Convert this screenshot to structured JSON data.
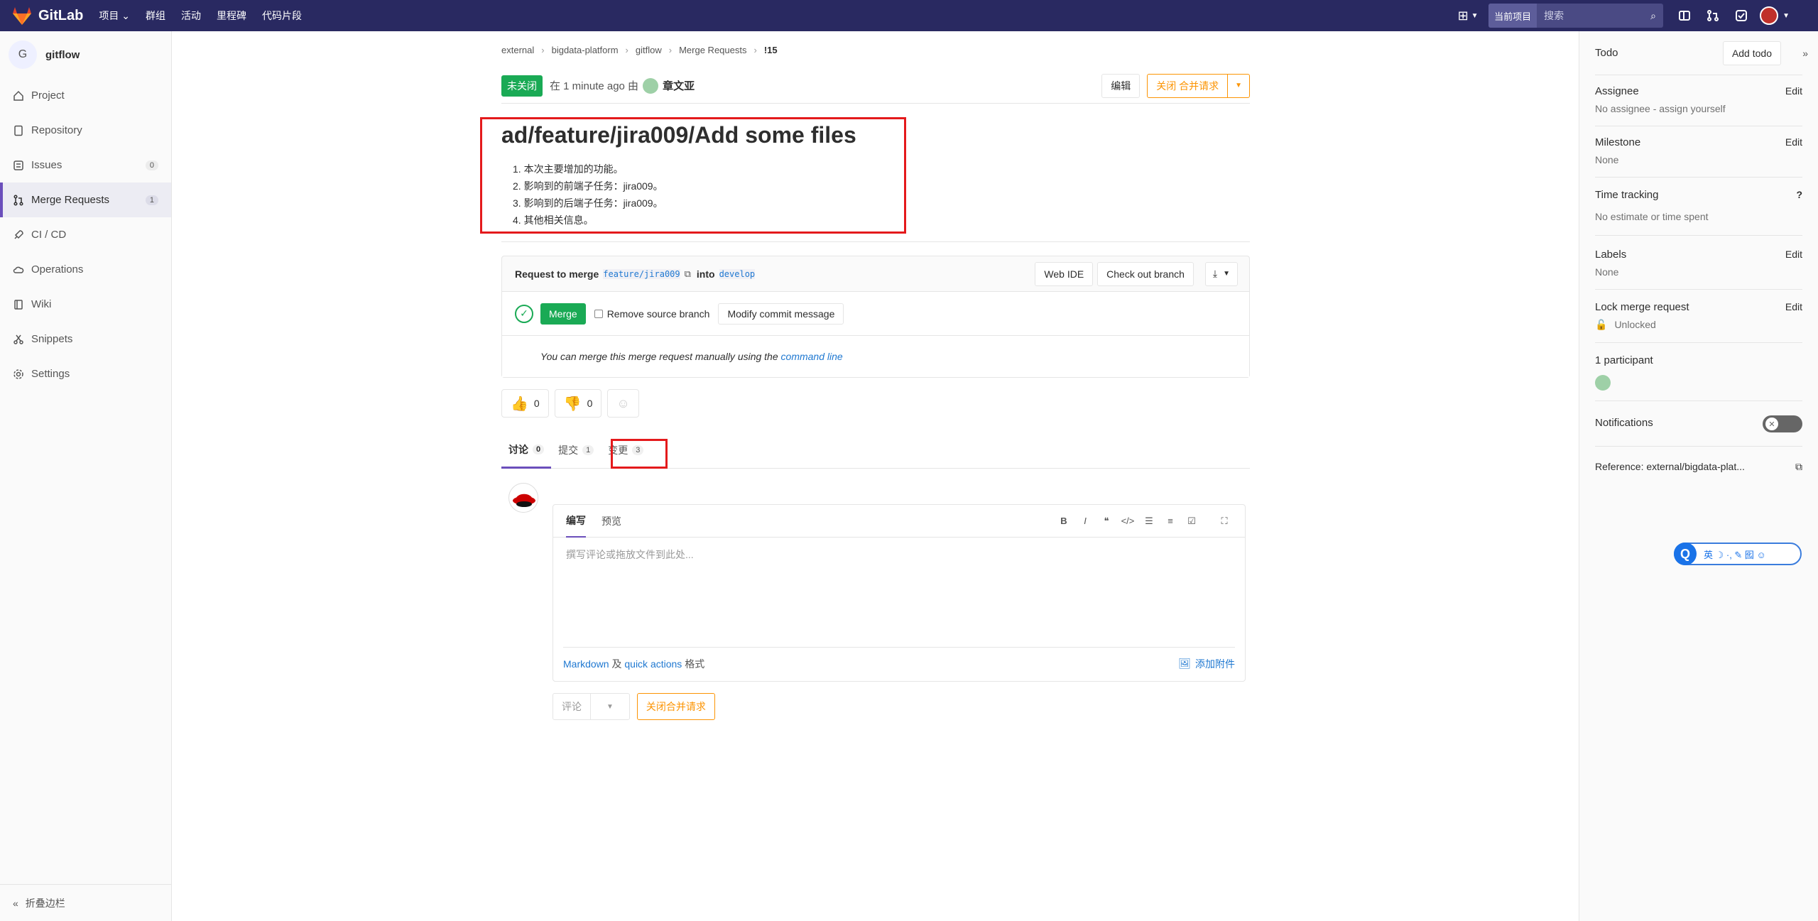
{
  "topnav": {
    "brand": "GitLab",
    "menu": [
      "项目 ⌄",
      "群组",
      "活动",
      "里程碑",
      "代码片段"
    ],
    "search_scope": "当前项目",
    "search_placeholder": "搜索"
  },
  "sidebar": {
    "project_initial": "G",
    "project_name": "gitflow",
    "items": [
      {
        "label": "Project",
        "icon": "home-icon"
      },
      {
        "label": "Repository",
        "icon": "doc-icon"
      },
      {
        "label": "Issues",
        "icon": "issues-icon",
        "badge": "0"
      },
      {
        "label": "Merge Requests",
        "icon": "merge-request-icon",
        "badge": "1",
        "active": true
      },
      {
        "label": "CI / CD",
        "icon": "rocket-icon"
      },
      {
        "label": "Operations",
        "icon": "cloud-icon"
      },
      {
        "label": "Wiki",
        "icon": "book-icon"
      },
      {
        "label": "Snippets",
        "icon": "scissors-icon"
      },
      {
        "label": "Settings",
        "icon": "gear-icon"
      }
    ],
    "collapse_label": "折叠边栏"
  },
  "breadcrumb": [
    "external",
    "bigdata-platform",
    "gitflow",
    "Merge Requests",
    "!15"
  ],
  "mr": {
    "status": "未关闭",
    "meta_prefix": "在 1 minute ago 由",
    "author": "章文亚",
    "edit_label": "编辑",
    "close_label": "关闭 合并请求",
    "title": "ad/feature/jira009/Add some files",
    "description": [
      "1. 本次主要增加的功能。",
      "2. 影响到的前端子任务：jira009。",
      "3. 影响到的后端子任务：jira009。",
      "4. 其他相关信息。"
    ]
  },
  "widget": {
    "request_text": "Request to merge",
    "source_branch": "feature/jira009",
    "into_text": "into",
    "target_branch": "develop",
    "web_ide": "Web IDE",
    "checkout": "Check out branch",
    "merge_label": "Merge",
    "remove_source": "Remove source branch",
    "modify_commit": "Modify commit message",
    "manual_text": "You can merge this merge request manually using the",
    "command_line": "command line"
  },
  "emoji": {
    "thumbs_up": "0",
    "thumbs_down": "0"
  },
  "tabs": [
    {
      "label": "讨论",
      "count": "0",
      "active": true
    },
    {
      "label": "提交",
      "count": "1"
    },
    {
      "label": "变更",
      "count": "3"
    }
  ],
  "editor": {
    "write_tab": "编写",
    "preview_tab": "预览",
    "placeholder": "撰写评论或拖放文件到此处...",
    "markdown": "Markdown",
    "and": "及",
    "quick_actions": "quick actions",
    "format": "格式",
    "attach": "添加附件",
    "comment_btn": "评论",
    "close_btn": "关闭合并请求"
  },
  "right": {
    "todo": "Todo",
    "add_todo": "Add todo",
    "assignee_title": "Assignee",
    "assignee_value": "No assignee - assign yourself",
    "milestone_title": "Milestone",
    "milestone_value": "None",
    "time_title": "Time tracking",
    "time_value": "No estimate or time spent",
    "labels_title": "Labels",
    "labels_value": "None",
    "lock_title": "Lock merge request",
    "lock_value": "Unlocked",
    "participants": "1 participant",
    "notifications": "Notifications",
    "reference": "Reference: external/bigdata-plat...",
    "edit": "Edit"
  },
  "floatbar": {
    "label": "英 ☽ ·, ✎ 囮 ☺"
  }
}
